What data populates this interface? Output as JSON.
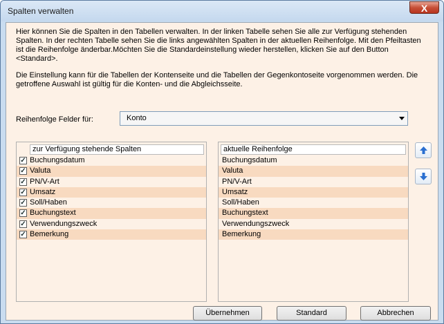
{
  "window": {
    "title": "Spalten verwalten",
    "close_symbol": "X"
  },
  "description": {
    "paragraph1": "Hier können Sie die Spalten in den Tabellen verwalten. In der linken Tabelle sehen Sie alle zur Verfügung stehenden Spalten. In der rechten Tabelle sehen Sie die links angewählten Spalten in der aktuellen Reihenfolge. Mit den Pfeiltasten ist die Reihenfolge änderbar.Möchten Sie die Standardeinstellung  wieder herstellen, klicken Sie auf den Button <Standard>.",
    "paragraph2": "Die Einstellung kann für die Tabellen der Kontenseite und die Tabellen der Gegenkontoseite vorgenommen werden. Die getroffene Auswahl ist gültig für die Konten- und die Abgleichsseite."
  },
  "order_for": {
    "label": "Reihenfolge Felder für:",
    "value": "Konto"
  },
  "available": {
    "header": "zur Verfügung stehende Spalten",
    "items": [
      {
        "label": "Buchungsdatum",
        "checked": true
      },
      {
        "label": "Valuta",
        "checked": true
      },
      {
        "label": "PN/V-Art",
        "checked": true
      },
      {
        "label": "Umsatz",
        "checked": true
      },
      {
        "label": "Soll/Haben",
        "checked": true
      },
      {
        "label": "Buchungstext",
        "checked": true
      },
      {
        "label": "Verwendungszweck",
        "checked": true
      },
      {
        "label": "Bemerkung",
        "checked": true
      }
    ]
  },
  "current": {
    "header": "aktuelle Reihenfolge",
    "items": [
      "Buchungsdatum",
      "Valuta",
      "PN/V-Art",
      "Umsatz",
      "Soll/Haben",
      "Buchungstext",
      "Verwendungszweck",
      "Bemerkung"
    ]
  },
  "buttons": {
    "apply": "Übernehmen",
    "standard": "Standard",
    "cancel": "Abbrechen"
  },
  "colors": {
    "arrow": "#2a6fd0",
    "row_alt": "#f8dac0",
    "content_bg": "#fdf1e6"
  }
}
